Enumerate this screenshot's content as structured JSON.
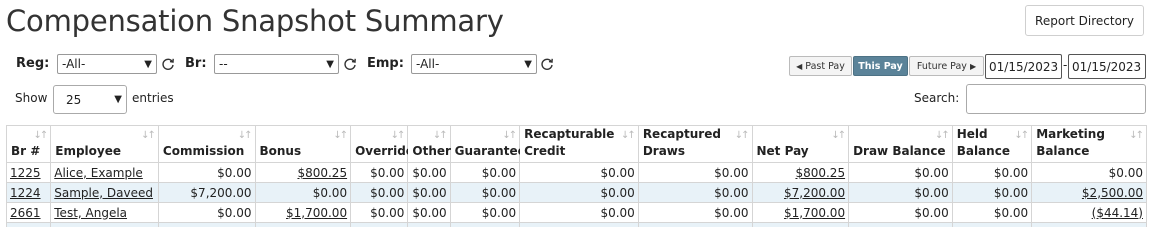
{
  "header": {
    "title": "Compensation Snapshot Summary",
    "report_directory_label": "Report Directory"
  },
  "filters": {
    "reg_label": "Reg:",
    "reg_value": "-All-",
    "br_label": "Br:",
    "br_value": "--",
    "emp_label": "Emp:",
    "emp_value": "-All-"
  },
  "pay_nav": {
    "past_pay": "Past Pay",
    "this_pay": "This Pay",
    "future_pay": "Future Pay",
    "start_date": "01/15/2023",
    "end_date": "01/15/2023",
    "date_separator": "-"
  },
  "table_controls": {
    "show_label": "Show",
    "page_size": "25",
    "entries_label": "entries",
    "search_label": "Search:",
    "search_value": ""
  },
  "table": {
    "columns": [
      {
        "line1": "",
        "line2": "Br #"
      },
      {
        "line1": "",
        "line2": "Employee"
      },
      {
        "line1": "",
        "line2": "Commission"
      },
      {
        "line1": "",
        "line2": "Bonus"
      },
      {
        "line1": "",
        "line2": "Override"
      },
      {
        "line1": "",
        "line2": "Other"
      },
      {
        "line1": "",
        "line2": "Guarantee"
      },
      {
        "line1": "Recapturable",
        "line2": "Credit"
      },
      {
        "line1": "Recaptured",
        "line2": "Draws"
      },
      {
        "line1": "",
        "line2": "Net Pay"
      },
      {
        "line1": "",
        "line2": "Draw Balance"
      },
      {
        "line1": "Held",
        "line2": "Balance"
      },
      {
        "line1": "Marketing",
        "line2": "Balance"
      }
    ],
    "rows": [
      [
        "1225",
        "Alice, Example",
        "$0.00",
        "$800.25",
        "$0.00",
        "$0.00",
        "$0.00",
        "$0.00",
        "$0.00",
        "$800.25",
        "$0.00",
        "$0.00",
        "$0.00"
      ],
      [
        "1224",
        "Sample, Daveed",
        "$7,200.00",
        "$0.00",
        "$0.00",
        "$0.00",
        "$0.00",
        "$0.00",
        "$0.00",
        "$7,200.00",
        "$0.00",
        "$0.00",
        "$2,500.00"
      ],
      [
        "2661",
        "Test, Angela",
        "$0.00",
        "$1,700.00",
        "$0.00",
        "$0.00",
        "$0.00",
        "$0.00",
        "$0.00",
        "$1,700.00",
        "$0.00",
        "$0.00",
        "($44.14)"
      ]
    ]
  },
  "colors": {
    "active_button": "#5b8399",
    "row_stripe": "#e8f2f8",
    "border": "#d5d5d5"
  }
}
